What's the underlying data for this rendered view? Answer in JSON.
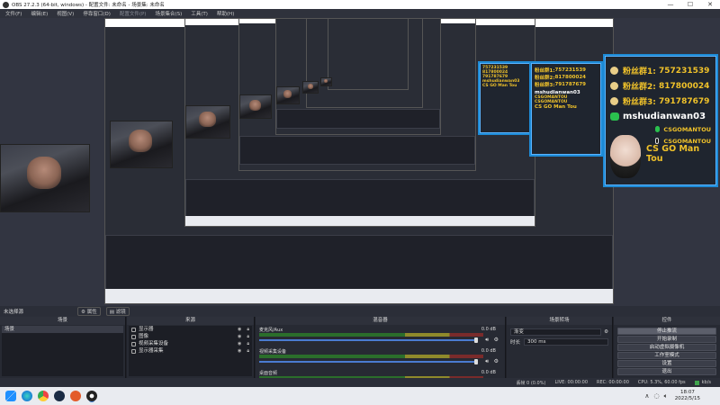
{
  "window": {
    "title": "OBS 27.2.3 (64-bit, windows) - 配置文件: 未命名 - 场景集: 未命名",
    "minimize": "—",
    "maximize": "☐",
    "close": "✕"
  },
  "menu": [
    "文件(F)",
    "编辑(E)",
    "视图(V)",
    "停靠窗口(D)",
    "配置文件(P)",
    "场景集合(S)",
    "工具(T)",
    "帮助(H)"
  ],
  "fan_card": {
    "lines": [
      {
        "label": "粉丝群1:",
        "value": "757231539"
      },
      {
        "label": "粉丝群2:",
        "value": "817800024"
      },
      {
        "label": "粉丝群3:",
        "value": "791787679"
      }
    ],
    "wechat": "mshudianwan03",
    "wechat2": "CSGOMANTOU",
    "douyin": "CSGOMANTOU",
    "name": "CS GO Man Tou"
  },
  "scene_bar": {
    "label": "未选择源",
    "properties": "属性",
    "filters": "滤镜"
  },
  "docks": {
    "scenes": {
      "title": "场景",
      "items": [
        "场景"
      ]
    },
    "sources": {
      "title": "来源",
      "items": [
        "显示器",
        "图像",
        "视频采集设备",
        "显示器采集"
      ]
    },
    "mixer": {
      "title": "混音器",
      "channels": [
        {
          "name": "麦克风/Aux",
          "db": "0.0 dB"
        },
        {
          "name": "视频采集设备",
          "db": "0.0 dB"
        },
        {
          "name": "桌面音频",
          "db": "0.0 dB"
        }
      ]
    },
    "transitions": {
      "title": "场景转场",
      "type": "渐变",
      "duration_label": "时长",
      "duration": "300 ms"
    },
    "controls": {
      "title": "控件",
      "buttons": [
        "停止推流",
        "开始录制",
        "启动虚拟摄像机",
        "工作室模式",
        "设置",
        "退出"
      ]
    }
  },
  "status": {
    "dropped": "丢帧 0 (0.0%)",
    "live": "LIVE: 00:00:00",
    "rec": "REC: 00:00:00",
    "cpu": "CPU: 5.3%, 60.00 fps",
    "bitrate": "kb/s"
  },
  "taskbar": {
    "time": "18:07",
    "date": "2022/5/15"
  }
}
